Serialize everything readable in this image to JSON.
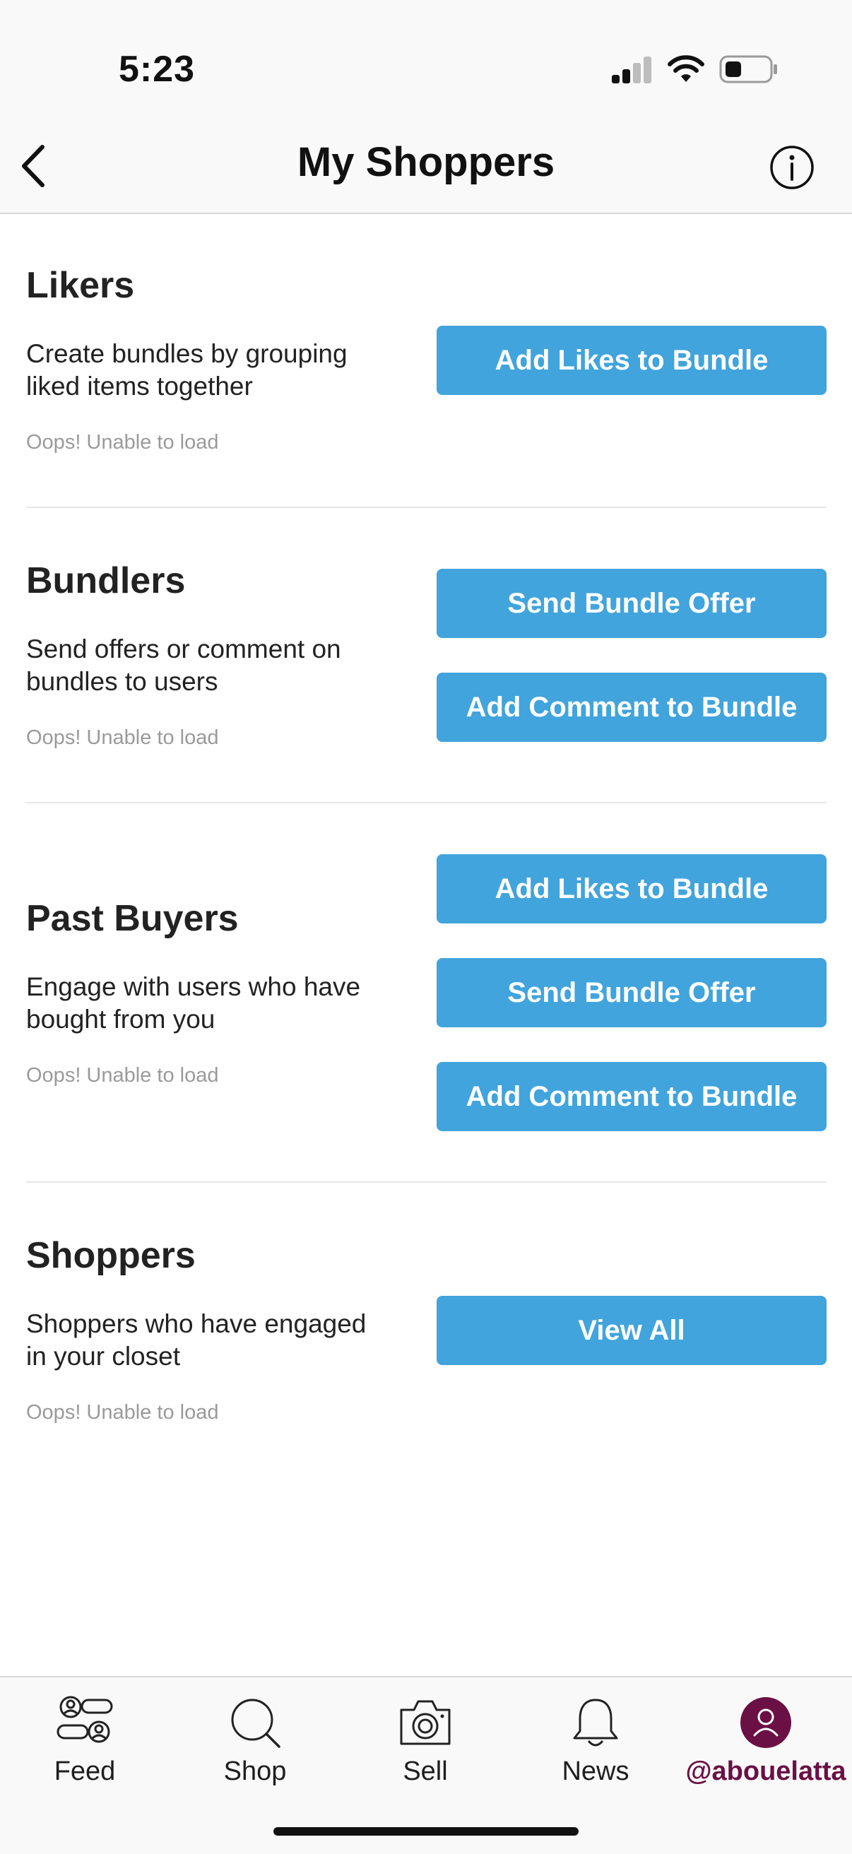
{
  "status_bar": {
    "time": "5:23"
  },
  "header": {
    "title": "My Shoppers"
  },
  "sections": [
    {
      "title": "Likers",
      "description": "Create bundles by grouping liked items together",
      "status": "Oops! Unable to load",
      "buttons": [
        "Add Likes to Bundle"
      ]
    },
    {
      "title": "Bundlers",
      "description": "Send offers or comment on bundles to users",
      "status": "Oops! Unable to load",
      "buttons": [
        "Send Bundle Offer",
        "Add Comment to Bundle"
      ]
    },
    {
      "title": "Past Buyers",
      "description": "Engage with users who have bought from you",
      "status": "Oops! Unable to load",
      "buttons": [
        "Add Likes to Bundle",
        "Send Bundle Offer",
        "Add Comment to Bundle"
      ]
    },
    {
      "title": "Shoppers",
      "description": "Shoppers who have engaged in your closet",
      "status": "Oops! Unable to load",
      "buttons": [
        "View All"
      ]
    }
  ],
  "tabbar": {
    "items": [
      {
        "label": "Feed",
        "icon": "feed-icon"
      },
      {
        "label": "Shop",
        "icon": "search-icon"
      },
      {
        "label": "Sell",
        "icon": "camera-icon"
      },
      {
        "label": "News",
        "icon": "bell-icon"
      },
      {
        "label": "@abouelatta",
        "icon": "profile-icon",
        "active": true
      }
    ]
  },
  "colors": {
    "button": "#41a4dc",
    "active_tab": "#6a1044"
  }
}
